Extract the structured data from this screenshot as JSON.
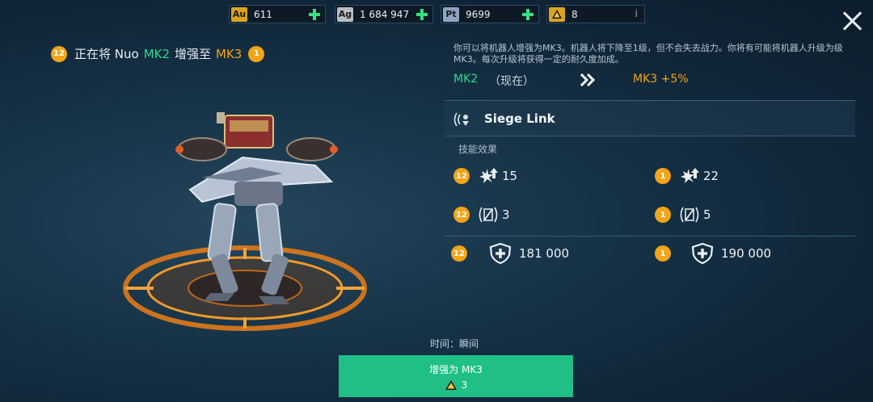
{
  "currencies": [
    {
      "code": "Au",
      "value": "611",
      "color": "#d9a520"
    },
    {
      "code": "Ag",
      "value": "1 684 947",
      "color": "#b8bec4"
    },
    {
      "code": "Pt",
      "value": "9699",
      "color": "#8fa4c0"
    },
    {
      "code": "",
      "value": "8",
      "info": "i"
    }
  ],
  "title": {
    "level_from": "12",
    "prefix": "正在将 Nuo",
    "mk_from": "MK2",
    "middle": "增强至",
    "mk_to": "MK3",
    "level_to": "1"
  },
  "description": "你可以将机器人增强为MK3。机器人将下降至1级，但不会失去战力。你将有可能将机器人升级为级MK3。每次升级将获得一定的耐久度加成。",
  "compare": {
    "from": "MK2",
    "from_note": "（现在）",
    "to": "MK3 +5%"
  },
  "skill": {
    "name": "Siege Link",
    "effects_label": "技能效果"
  },
  "stats": {
    "left": {
      "level": "12",
      "power": "15",
      "range": "3",
      "durability": "181 000"
    },
    "right": {
      "level": "1",
      "power": "22",
      "range": "5",
      "durability": "190 000"
    }
  },
  "time": {
    "label": "时间：",
    "value": "瞬间"
  },
  "action": {
    "label": "增强为 MK3",
    "cost": "3"
  },
  "colors": {
    "accent_green": "#2fd98b",
    "accent_orange": "#f2a516",
    "button": "#1fbf86"
  }
}
